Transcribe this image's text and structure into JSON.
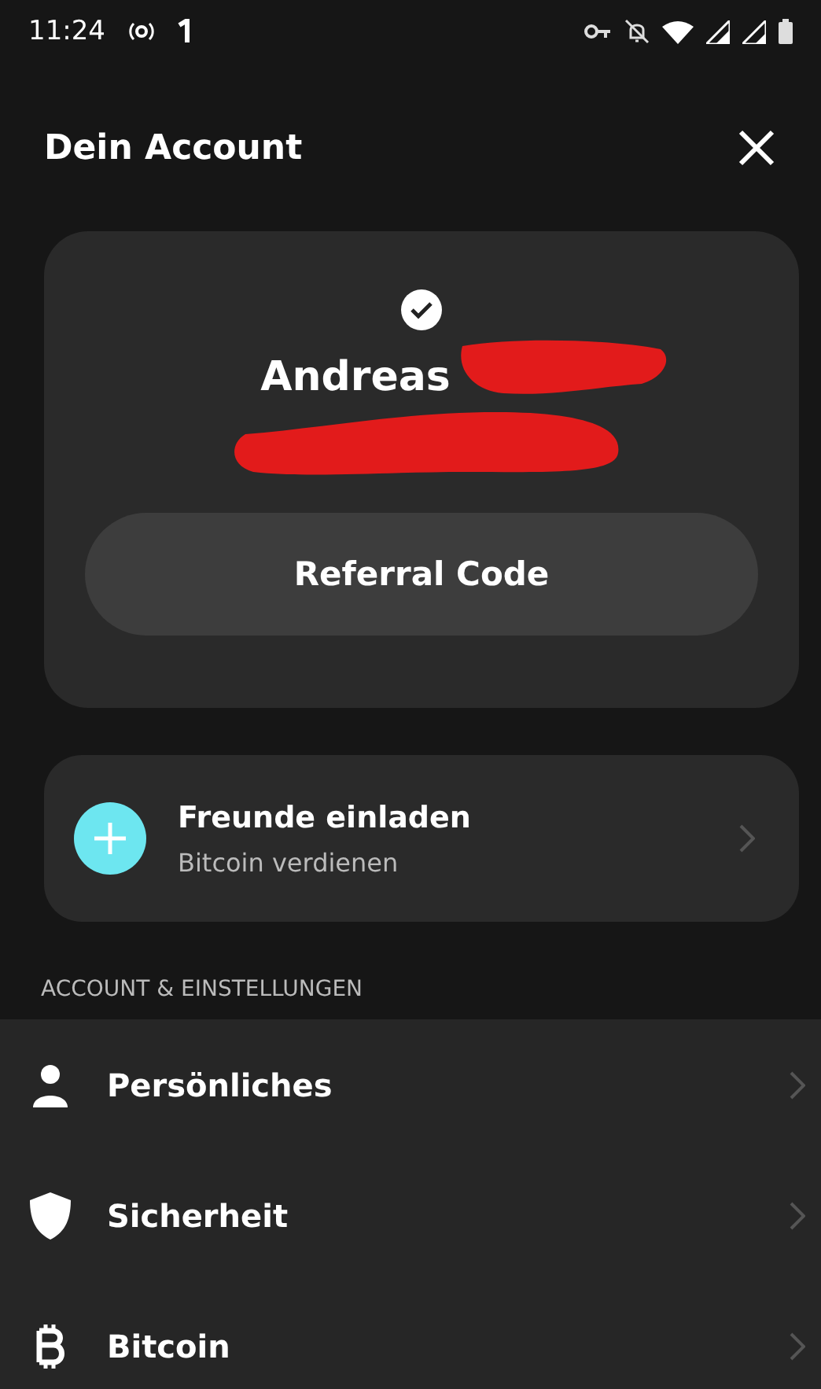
{
  "status_bar": {
    "time": "11:24"
  },
  "header": {
    "title": "Dein Account"
  },
  "profile": {
    "name": "Andreas",
    "verified": true,
    "redacted": true,
    "button": "Referral Code"
  },
  "invite": {
    "title": "Freunde einladen",
    "subtitle": "Bitcoin verdienen"
  },
  "section": {
    "heading": "ACCOUNT & EINSTELLUNGEN",
    "items": [
      {
        "label": "Persönliches"
      },
      {
        "label": "Sicherheit"
      },
      {
        "label": "Bitcoin"
      }
    ]
  }
}
